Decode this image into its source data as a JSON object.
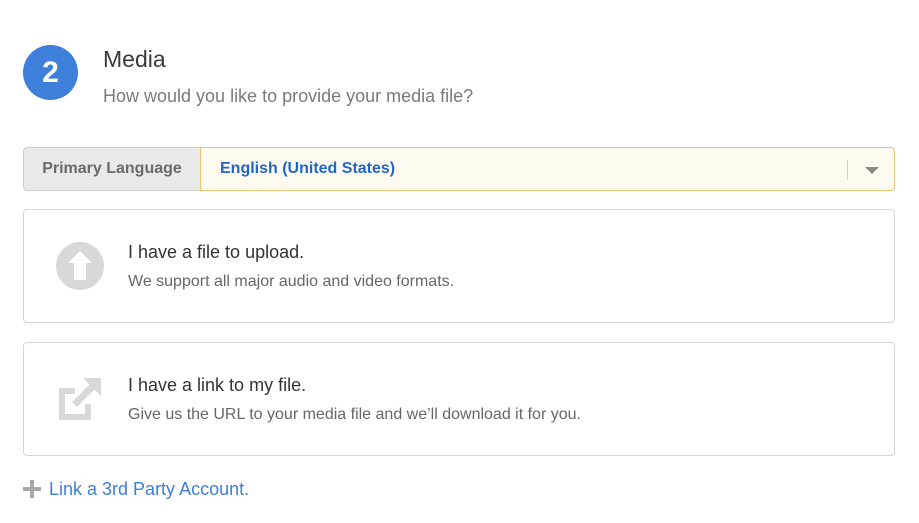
{
  "step": {
    "number": "2",
    "title": "Media",
    "subtitle": "How would you like to provide your media file?"
  },
  "language": {
    "label": "Primary Language",
    "selected": "English (United States)"
  },
  "options": [
    {
      "title": "I have a file to upload.",
      "description": "We support all major audio and video formats.",
      "icon": "upload-icon"
    },
    {
      "title": "I have a link to my file.",
      "description": "Give us the URL to your media file and we’ll download it for you.",
      "icon": "external-link-icon"
    }
  ],
  "third_party": {
    "label": "Link a 3rd Party Account.",
    "icon": "plus-icon"
  },
  "colors": {
    "accent": "#3d7fd9",
    "select_text": "#1f66c9",
    "select_border": "#f0c274",
    "icon_gray": "#d5d5d5"
  }
}
